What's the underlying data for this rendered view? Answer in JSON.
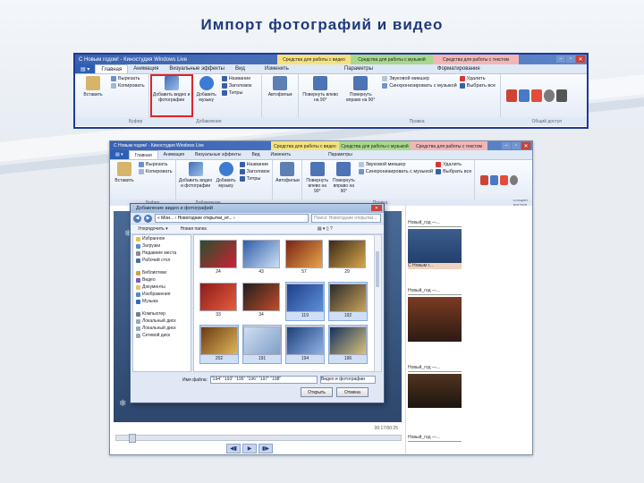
{
  "slide": {
    "title": "Импорт фотографий и видео"
  },
  "ribbon": {
    "window_title": "С Новым годом! - Киностудия Windows Live",
    "context_tabs": [
      "Средства для работы с видео",
      "Средства для работы с музыкой",
      "Средства для работы с текстом"
    ],
    "tabs": [
      "Главная",
      "Анимация",
      "Визуальные эффекты",
      "Вид",
      "Изменить",
      "Параметры",
      "Форматирование"
    ],
    "buttons": {
      "paste": "Вставить",
      "cut": "Вырезать",
      "copy": "Копировать",
      "add_video_photo": "Добавить видео и фотографии",
      "add_music": "Добавить музыку",
      "title": "Название",
      "caption": "Заголовок",
      "credits": "Титры",
      "automovie": "Автофильм",
      "rotate_left": "Повернуть влево на 90°",
      "rotate_right": "Повернуть вправо на 90°",
      "sound_mixer": "Звуковой микшер",
      "sync_music": "Синхронизировать с музыкой",
      "delete": "Удалить",
      "select_all": "Выбрать все"
    },
    "groups": {
      "clipboard": "Буфер",
      "add": "Добавление",
      "edit": "Правка",
      "share": "Общий доступ"
    }
  },
  "app": {
    "timecode": "00:17/00:25",
    "storyboard": [
      {
        "label": "Новый_год —...",
        "caption": "С Новым г..."
      },
      {
        "label": "Новый_год —..."
      },
      {
        "label": "Новый_год —..."
      },
      {
        "label": "Новый_год —..."
      }
    ]
  },
  "dialog": {
    "title": "Добавление видео и фотографий",
    "address": "« Мои... › Новогодние открытки_ит... ›",
    "search_placeholder": "Поиск: Новогодние открытки...",
    "toolbar": [
      "Упорядочить ▾",
      "Новая папка"
    ],
    "nav": [
      "Избранное",
      "Загрузки",
      "Недавние места",
      "Рабочий стол",
      "Библиотеки",
      "Видео",
      "Документы",
      "Изображения",
      "Музыка",
      "Компьютер",
      "Локальный диск",
      "Локальный диск",
      "Сетевой диск"
    ],
    "thumbs": [
      "24",
      "43",
      "57",
      "29",
      "33",
      "34",
      "119",
      "192",
      "202",
      "191",
      "194",
      "196"
    ],
    "filename_label": "Имя файла:",
    "filename_value": "\"194\" \"193\" \"195\" \"196\" \"197\" \"198\"",
    "filter": "Видео и фотографии",
    "open": "Открыть",
    "cancel": "Отмена"
  }
}
